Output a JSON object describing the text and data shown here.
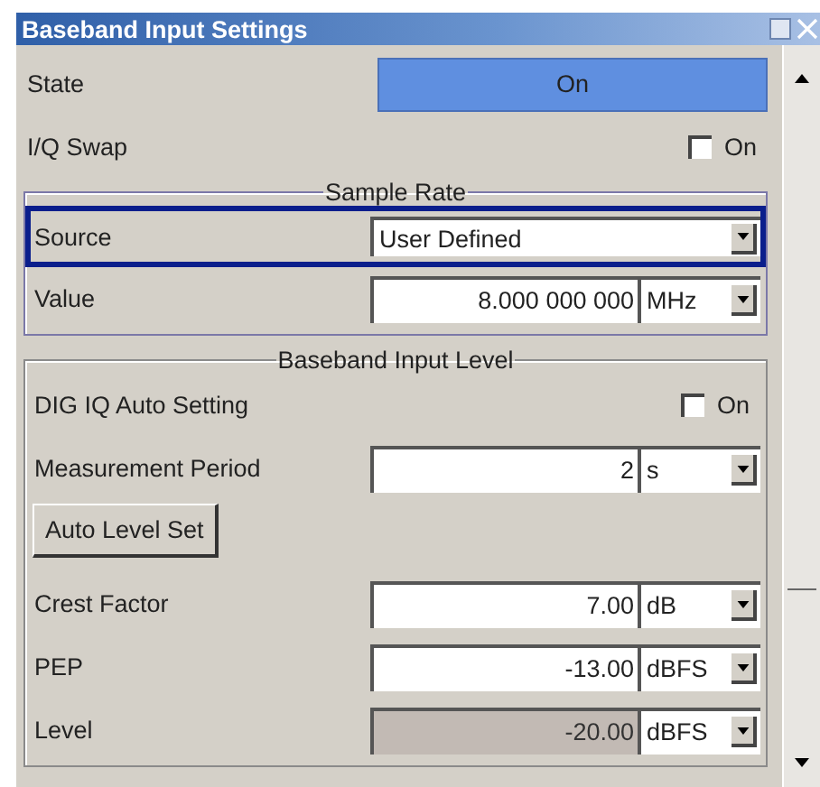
{
  "window": {
    "title": "Baseband Input Settings"
  },
  "rows": [
    {
      "kind": "toggle",
      "label": "State",
      "value": "On",
      "on": true
    },
    {
      "kind": "checkbox",
      "label": "I/Q Swap",
      "option": "On",
      "checked": false
    }
  ],
  "groups": [
    {
      "title": "Sample Rate",
      "rows": [
        {
          "kind": "select",
          "label": "Source",
          "value": "User Defined",
          "focused": true
        },
        {
          "kind": "number",
          "label": "Value",
          "value": "8.000 000 000",
          "unit": "MHz",
          "disabled": false
        }
      ]
    },
    {
      "title": "Baseband Input Level",
      "rows": [
        {
          "kind": "checkbox",
          "label": "DIG IQ Auto Setting",
          "option": "On",
          "checked": false
        },
        {
          "kind": "number",
          "label": "Measurement Period",
          "value": "2",
          "unit": "s",
          "disabled": false
        },
        {
          "kind": "button",
          "label": "Auto Level Set"
        },
        {
          "kind": "number",
          "label": "Crest Factor",
          "value": "7.00",
          "unit": "dB",
          "disabled": false
        },
        {
          "kind": "number",
          "label": "PEP",
          "value": "-13.00",
          "unit": "dBFS",
          "disabled": false
        },
        {
          "kind": "number",
          "label": "Level",
          "value": "-20.00",
          "unit": "dBFS",
          "disabled": true
        }
      ]
    }
  ]
}
